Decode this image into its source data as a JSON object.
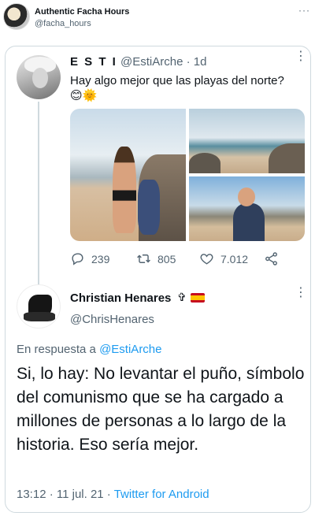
{
  "account": {
    "name": "Authentic Facha Hours",
    "handle": "@facha_hours",
    "more": "···"
  },
  "quoted_tweet": {
    "name": "E S T I",
    "handle_time": "@EstiArche · 1d",
    "text": "Hay algo mejor que las playas del norte?",
    "emoji": "😊🌞",
    "more": "⋮",
    "replies": "239",
    "retweets": "805",
    "likes": "7.012"
  },
  "main_tweet": {
    "name": "Christian Henares",
    "cross": "✞",
    "handle": "@ChrisHenares",
    "more": "⋮",
    "reply_prefix": "En respuesta a ",
    "reply_target": "@EstiArche",
    "text": "Si, lo hay: No levantar el puño, símbolo del comunismo que se ha cargado a millones de personas a lo largo de la historia. Eso sería mejor.",
    "timestamp": "13:12 · 11 jul. 21 · ",
    "source": "Twitter for Android"
  },
  "colors": {
    "link": "#1d9bf0",
    "secondary_text": "#536471",
    "border": "#cfd9de"
  },
  "icons": {
    "reply": "reply-icon",
    "retweet": "retweet-icon",
    "like": "heart-icon",
    "share": "share-icon",
    "flag": "spain-flag-icon"
  }
}
